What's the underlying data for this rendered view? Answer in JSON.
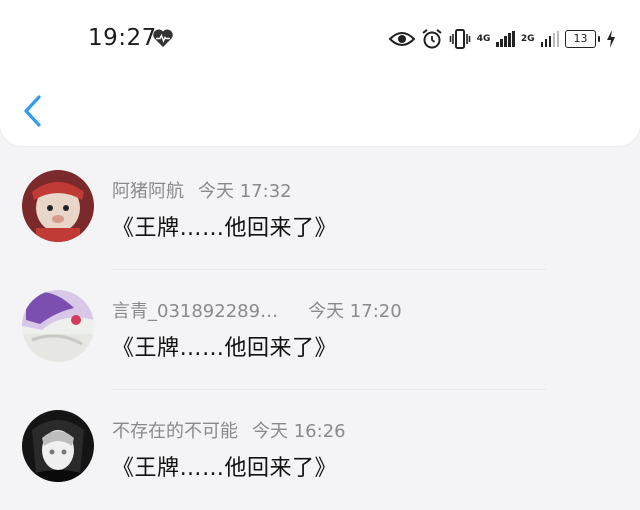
{
  "status_bar": {
    "time": "19:27",
    "net1": "4G",
    "net2": "2G",
    "battery": "13"
  },
  "comments": [
    {
      "username": "阿猪阿航",
      "timestamp": "今天 17:32",
      "message": "《王牌……他回来了》",
      "avatar_colors": [
        "#7a2a2a",
        "#e8d6c8",
        "#c23a36"
      ]
    },
    {
      "username": "言青_031892289…",
      "timestamp": "今天 17:20",
      "message": "《王牌……他回来了》",
      "avatar_colors": [
        "#7b4fb0",
        "#eef0ee",
        "#d9c7e8"
      ]
    },
    {
      "username": "不存在的不可能",
      "timestamp": "今天 16:26",
      "message": "《王牌……他回来了》",
      "avatar_colors": [
        "#141414",
        "#f0f0f0",
        "#7a7a7a"
      ]
    }
  ],
  "accent_color": "#2f9cf0"
}
